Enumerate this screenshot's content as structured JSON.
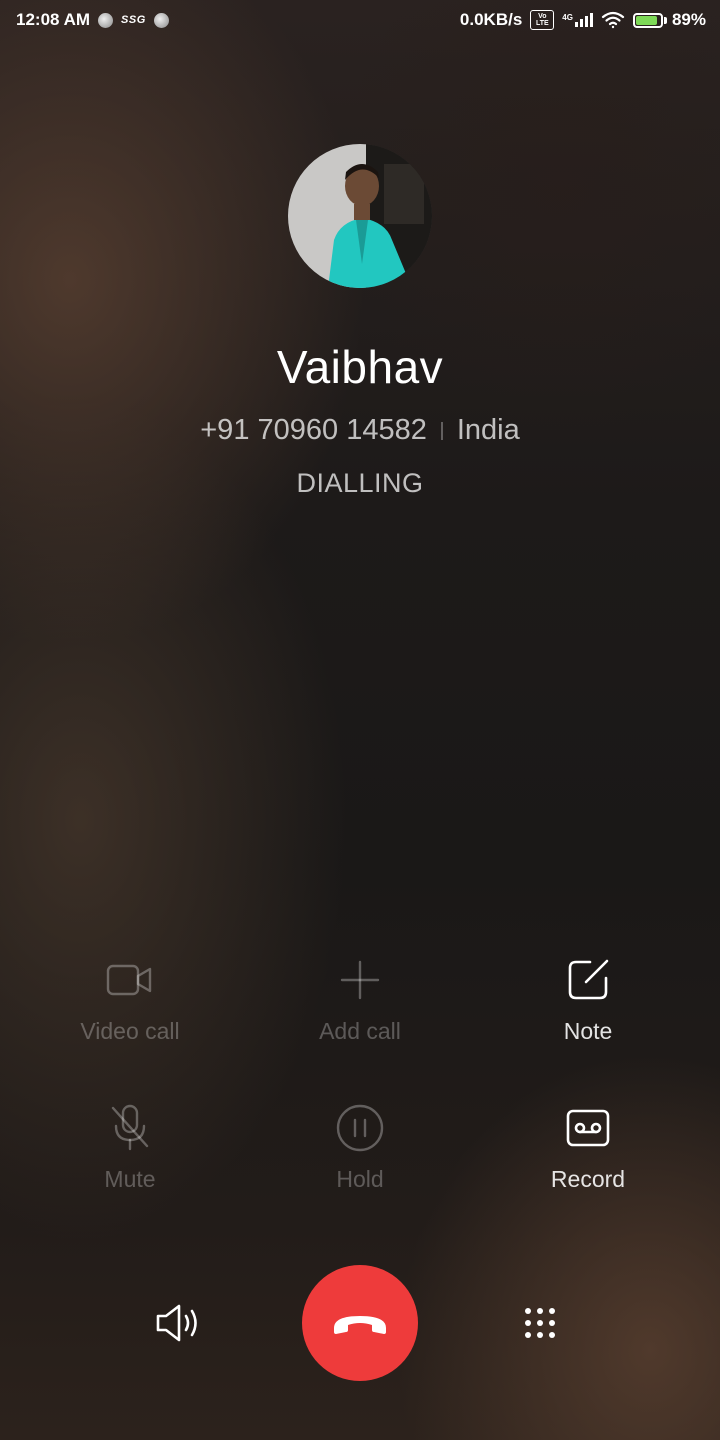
{
  "status_bar": {
    "time": "12:08 AM",
    "carrier_tag": "SSG",
    "net_speed": "0.0KB/s",
    "volte_badge": "Vo LTE",
    "signal_tag": "4G",
    "battery_percent": "89%",
    "battery_level": 0.89,
    "battery_color": "#7ed957"
  },
  "caller": {
    "name": "Vaibhav",
    "number": "+91 70960 14582",
    "location": "India",
    "status": "DIALLING"
  },
  "actions": {
    "video_call": {
      "label": "Video call",
      "icon": "video-camera-icon",
      "enabled": false
    },
    "add_call": {
      "label": "Add call",
      "icon": "plus-icon",
      "enabled": false
    },
    "note": {
      "label": "Note",
      "icon": "note-edit-icon",
      "enabled": true
    },
    "mute": {
      "label": "Mute",
      "icon": "microphone-off-icon",
      "enabled": false
    },
    "hold": {
      "label": "Hold",
      "icon": "pause-circle-icon",
      "enabled": false
    },
    "record": {
      "label": "Record",
      "icon": "tape-record-icon",
      "enabled": true
    }
  },
  "controls": {
    "speaker_icon": "speaker-icon",
    "end_call_icon": "hang-up-icon",
    "end_call_color": "#ee3b3b",
    "keypad_icon": "dialpad-icon"
  }
}
